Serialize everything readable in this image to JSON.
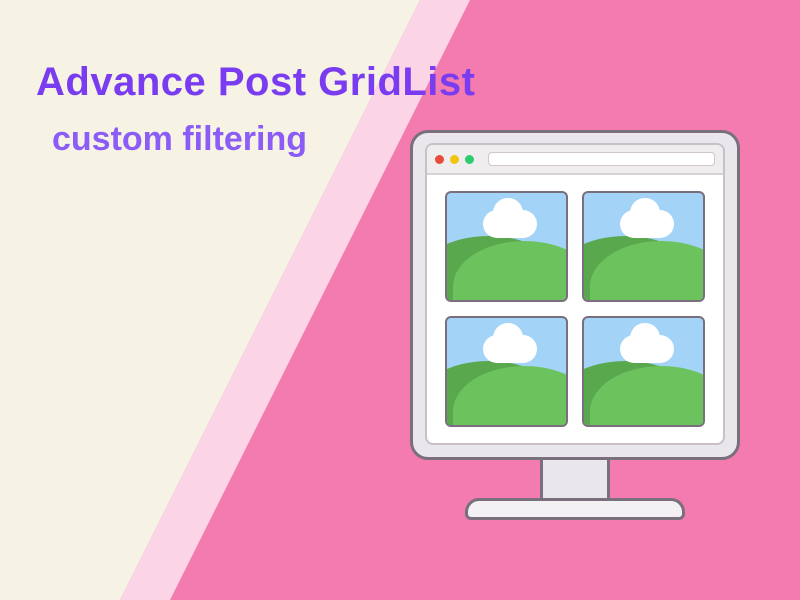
{
  "heading": {
    "title": "Advance Post GridList",
    "subtitle": "custom filtering"
  },
  "monitor": {
    "traffic_lights": [
      "red",
      "yellow",
      "green"
    ],
    "thumbnails": 4
  },
  "colors": {
    "bg_pink": "#f47bb0",
    "bg_cream": "#f7f3e4",
    "bg_lightpink": "#fbd5e6",
    "title": "#7a3cf0",
    "subtitle": "#8b5cf6"
  }
}
